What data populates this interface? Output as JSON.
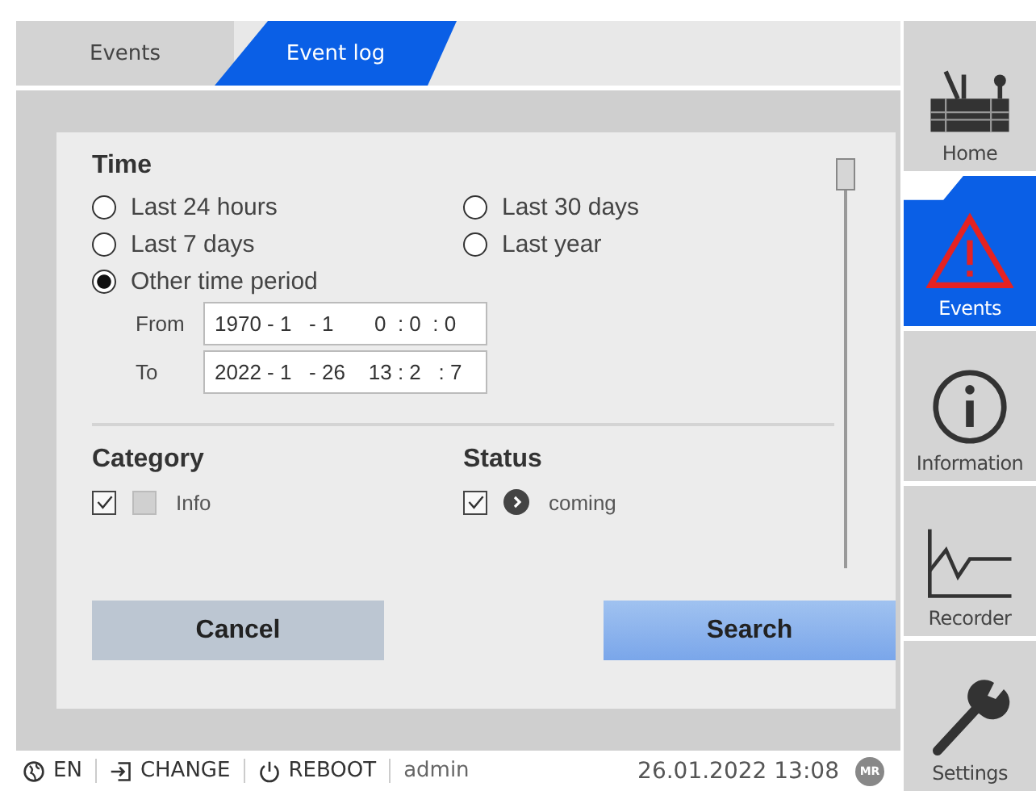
{
  "tabs": [
    {
      "label": "Events",
      "selected": false
    },
    {
      "label": "Event log",
      "selected": true
    }
  ],
  "time": {
    "heading": "Time",
    "options": [
      {
        "label": "Last 24 hours",
        "selected": false
      },
      {
        "label": "Last 30 days",
        "selected": false
      },
      {
        "label": "Last 7 days",
        "selected": false
      },
      {
        "label": "Last year",
        "selected": false
      },
      {
        "label": "Other time period",
        "selected": true
      }
    ],
    "from": {
      "label": "From",
      "value": "1970 - 1   - 1       0  : 0  : 0"
    },
    "to": {
      "label": "To",
      "value": "2022 - 1   - 26    13 : 2   : 7"
    }
  },
  "category": {
    "heading": "Category",
    "items": [
      {
        "label": "Info",
        "checked": true
      }
    ]
  },
  "status": {
    "heading": "Status",
    "items": [
      {
        "label": "coming",
        "checked": true
      }
    ]
  },
  "buttons": [
    {
      "label": "Cancel",
      "kind": "secondary"
    },
    {
      "label": "Search",
      "kind": "primary"
    }
  ],
  "nav": [
    {
      "label": "Home",
      "selected": false
    },
    {
      "label": "Events",
      "selected": true
    },
    {
      "label": "Information",
      "selected": false
    },
    {
      "label": "Recorder",
      "selected": false
    },
    {
      "label": "Settings",
      "selected": false
    }
  ],
  "status_bar": {
    "language": "EN",
    "change": "CHANGE",
    "reboot": "REBOOT",
    "user": "admin",
    "datetime": "26.01.2022 13:08",
    "logo": "MR"
  }
}
